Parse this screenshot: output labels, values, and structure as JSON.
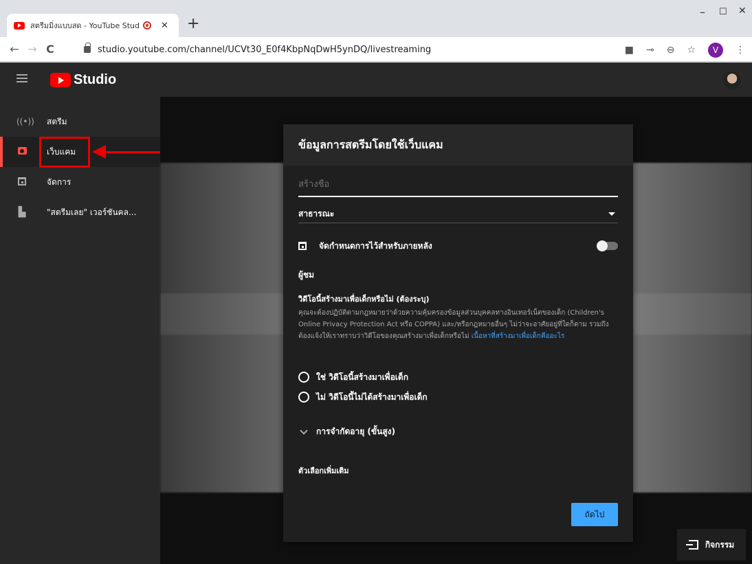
{
  "browser": {
    "tab_title": "สตรีมมิ่งแบบสด - YouTube Stud",
    "close_glyph": "✕",
    "newtab_glyph": "+",
    "url": "studio.youtube.com/channel/UCVt30_E0f4KbpNqDwH5ynDQ/livestreaming",
    "profile_initial": "V",
    "window_min": "–",
    "window_max": "☐",
    "window_close": "✕",
    "back_glyph": "←",
    "forward_glyph": "→",
    "reload_glyph": "C",
    "cam_glyph": "■",
    "key_glyph": "⊸",
    "zoom_glyph": "⊖",
    "star_glyph": "☆",
    "menu_glyph": "⋮"
  },
  "header": {
    "logo_text": "Studio"
  },
  "sidebar": {
    "items": [
      {
        "label": "สตรีม",
        "icon": "((•))"
      },
      {
        "label": "เว็บแคม"
      },
      {
        "label": "จัดการ"
      },
      {
        "label": "\"สตรีมเลย\" เวอร์ชันคล..."
      }
    ]
  },
  "dialog": {
    "title": "ข้อมูลการสตรีมโดยใช้เว็บแคม",
    "title_placeholder": "สร้างชื่อ",
    "privacy_value": "สาธารณะ",
    "schedule_label": "จัดกำหนดการไว้สำหรับภายหลัง",
    "audience_heading": "ผู้ชม",
    "kids_question": "วิดีโอนี้สร้างมาเพื่อเด็กหรือไม่ (ต้องระบุ)",
    "kids_description": "คุณจะต้องปฏิบัติตามกฎหมายว่าด้วยความคุ้มครองข้อมูลส่วนบุคคลทางอินเทอร์เน็ตของเด็ก (Children's Online Privacy Protection Act หรือ COPPA) และ/หรือกฎหมายอื่นๆ ไม่ว่าจะอาศัยอยู่ที่ใดก็ตาม รวมถึงต้องแจ้งให้เราทราบว่าวิดีโอของคุณสร้างมาเพื่อเด็กหรือไม่ ",
    "kids_link": "เนื้อหาที่สร้างมาเพื่อเด็กคืออะไร",
    "radio_yes": "ใช่ วิดีโอนี้สร้างมาเพื่อเด็ก",
    "radio_no": "ไม่ วิดีโอนี้ไม่ได้สร้างมาเพื่อเด็ก",
    "age_restriction": "การจำกัดอายุ (ขั้นสูง)",
    "more_options": "ตัวเลือกเพิ่มเติม",
    "next_button": "ถัดไป"
  },
  "activity": {
    "label": "กิจกรรม"
  }
}
